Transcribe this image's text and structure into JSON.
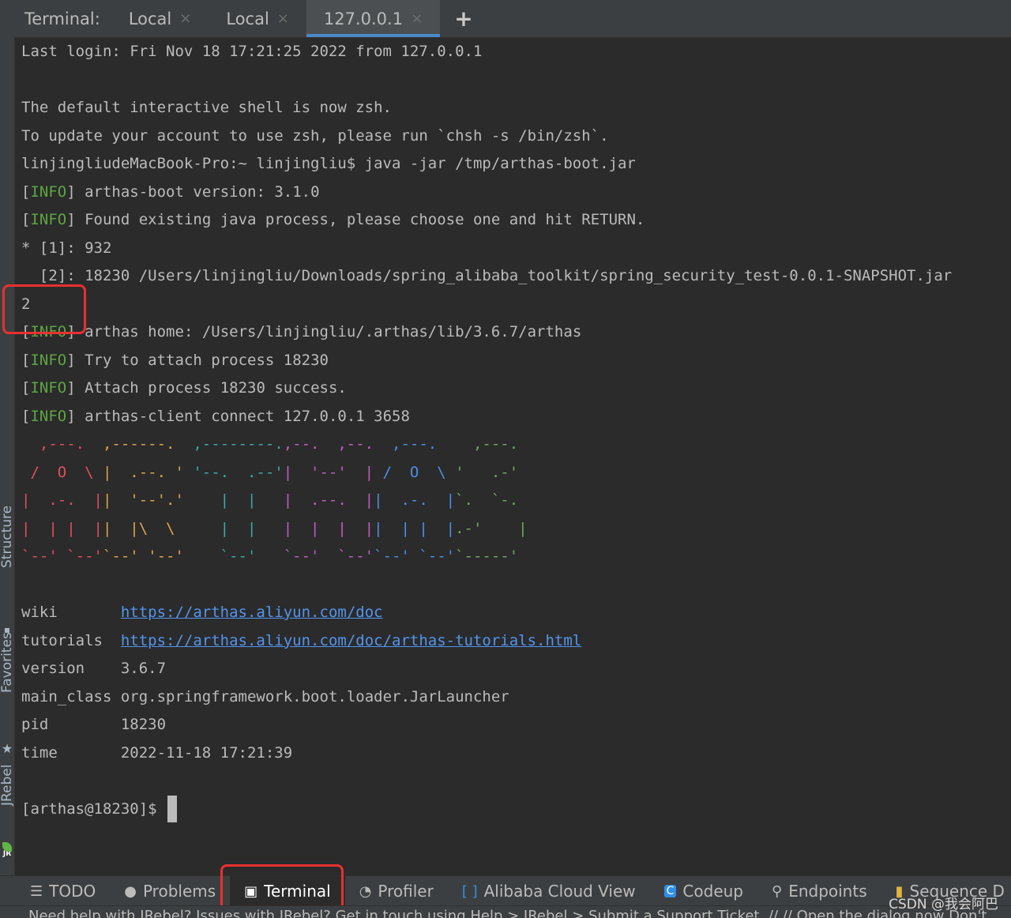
{
  "sidebar": {
    "structure": "Structure",
    "favorites": "Favorites",
    "jrebel": "JRebel",
    "jr_badge": "JR"
  },
  "tabs": {
    "title": "Terminal:",
    "items": [
      {
        "label": "Local",
        "close": "×"
      },
      {
        "label": "Local",
        "close": "×"
      },
      {
        "label": "127.0.0.1",
        "close": "×"
      }
    ],
    "add": "+"
  },
  "terminal": {
    "last_login": "Last login: Fri Nov 18 17:21:25 2022 from 127.0.0.1",
    "default_shell": "The default interactive shell is now zsh.",
    "update_note": "To update your account to use zsh, please run `chsh -s /bin/zsh`.",
    "command": "linjingliudeMacBook-Pro:~ linjingliu$ java -jar /tmp/arthas-boot.jar",
    "info_tag": "INFO",
    "msg_version": "arthas-boot version: 3.1.0",
    "msg_found": "Found existing java process, please choose one and hit RETURN.",
    "proc1": "* [1]: 932",
    "proc2": "  [2]: 18230 /Users/linjingliu/Downloads/spring_alibaba_toolkit/spring_security_test-0.0.1-SNAPSHOT.jar",
    "choice": "2",
    "msg_home": "arthas home: /Users/linjingliu/.arthas/lib/3.6.7/arthas",
    "msg_try": "Try to attach process 18230",
    "msg_attach": "Attach process 18230 success.",
    "msg_client": "arthas-client connect 127.0.0.1 3658",
    "info": {
      "wiki_key": "wiki",
      "wiki_val": "https://arthas.aliyun.com/doc",
      "tutorials_key": "tutorials",
      "tutorials_val": "https://arthas.aliyun.com/doc/arthas-tutorials.html",
      "version_key": "version",
      "version_val": "3.6.7",
      "main_class_key": "main_class",
      "main_class_val": "org.springframework.boot.loader.JarLauncher",
      "pid_key": "pid",
      "pid_val": "18230",
      "time_key": "time",
      "time_val": "2022-11-18 17:21:39"
    },
    "prompt": "[arthas@18230]$"
  },
  "banner_colors": [
    "#e04f5f",
    "#d9a64a",
    "#3aa8a8",
    "#bc5ec1",
    "#4a8ee6",
    "#6aaa5a"
  ],
  "bottom_tools": [
    {
      "label": "TODO",
      "icon": "list-icon"
    },
    {
      "label": "Problems",
      "icon": "info-icon"
    },
    {
      "label": "Terminal",
      "icon": "terminal-icon"
    },
    {
      "label": "Profiler",
      "icon": "profiler-icon"
    },
    {
      "label": "Alibaba Cloud View",
      "icon": "cloud-icon"
    },
    {
      "label": "Codeup",
      "icon": "codeup-icon"
    },
    {
      "label": "Endpoints",
      "icon": "endpoints-icon"
    },
    {
      "label": "Sequence D",
      "icon": "sequence-icon"
    }
  ],
  "status": "Need help with JRebel? Issues with JRebel? Get in touch using Help > JRebel > Submit a Support Ticket. // // Open the dialog now  Don't",
  "watermark": "CSDN @我会阿巴"
}
